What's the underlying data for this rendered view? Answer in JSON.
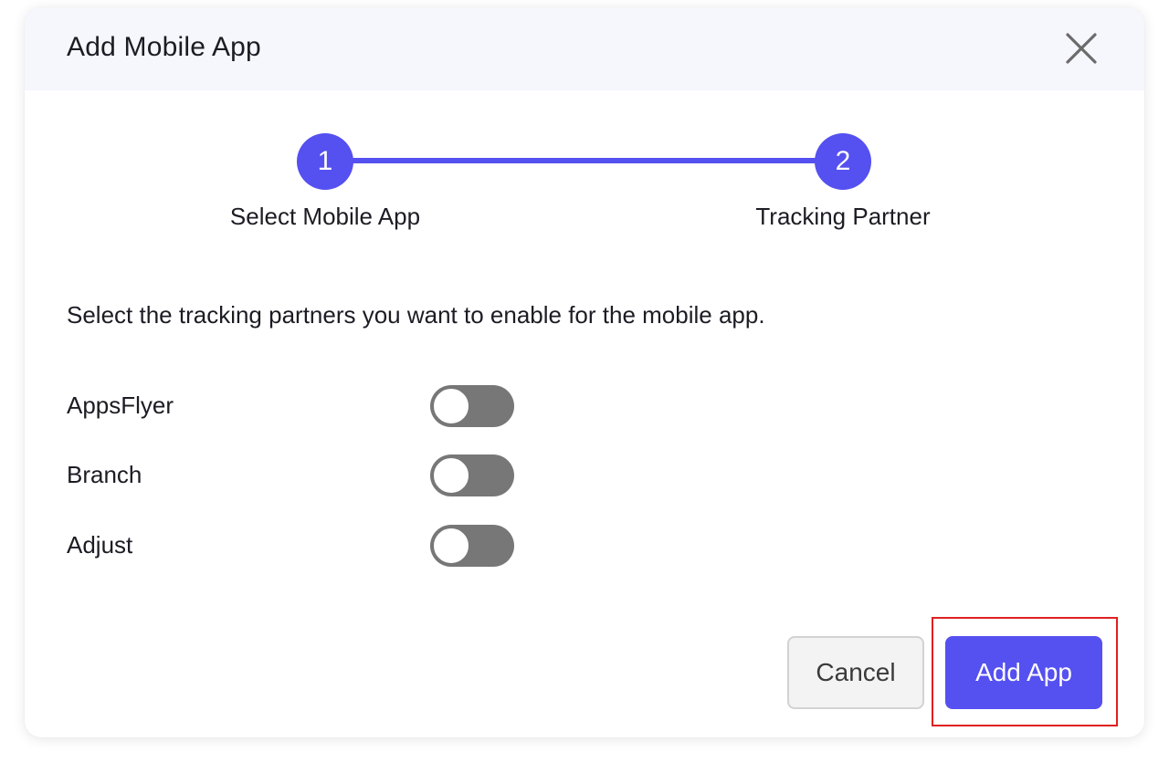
{
  "modal": {
    "title": "Add Mobile App",
    "close_icon": "close-icon"
  },
  "stepper": {
    "steps": [
      {
        "number": "1",
        "label": "Select Mobile App",
        "state": "completed"
      },
      {
        "number": "2",
        "label": "Tracking Partner",
        "state": "active"
      }
    ],
    "accent_color": "#5550f0"
  },
  "content": {
    "instruction": "Select the tracking partners you want to enable for the mobile app.",
    "partners": [
      {
        "name": "AppsFlyer",
        "enabled": false
      },
      {
        "name": "Branch",
        "enabled": false
      },
      {
        "name": "Adjust",
        "enabled": false
      }
    ]
  },
  "footer": {
    "cancel_label": "Cancel",
    "add_label": "Add App"
  },
  "colors": {
    "primary": "#5550f0",
    "header_bg": "#f6f6fd",
    "toggle_off": "#777777",
    "highlight": "#e02020"
  }
}
